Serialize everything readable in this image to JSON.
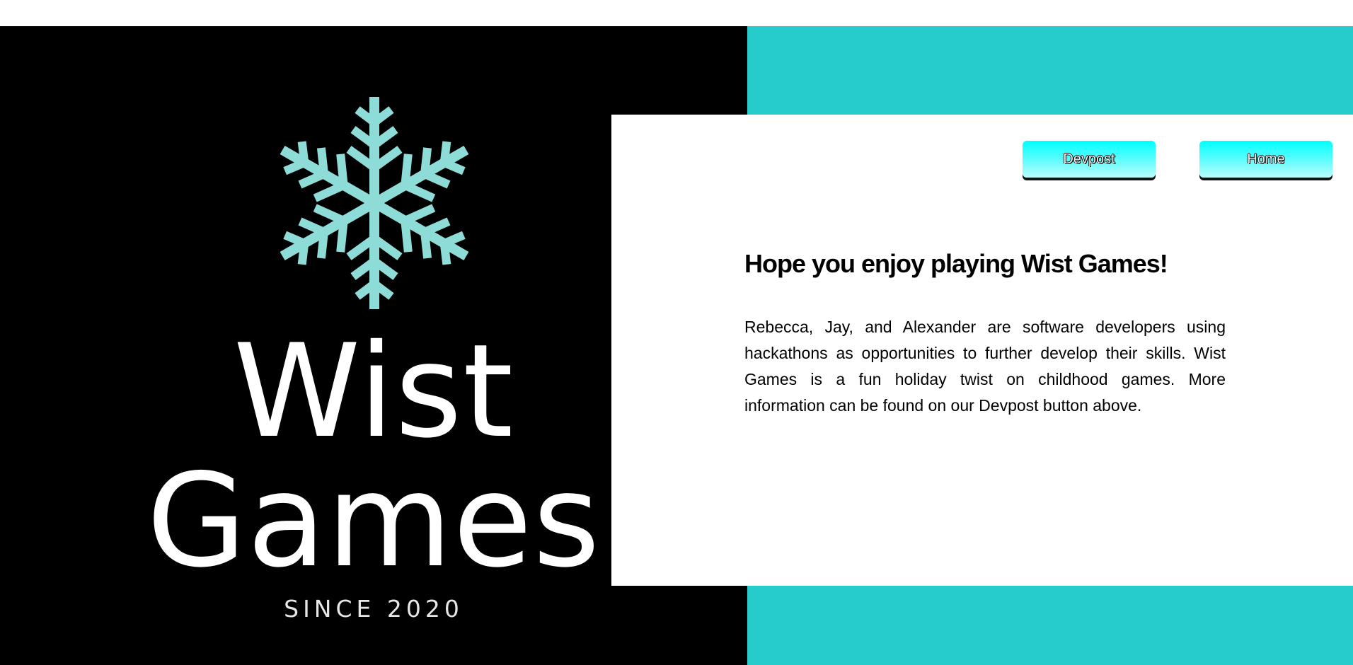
{
  "colors": {
    "logo_background": "#000000",
    "accent_teal": "#26cbcb",
    "snowflake": "#8edcd8",
    "button_gradient_top": "#00ffff",
    "card_background": "#ffffff"
  },
  "logo": {
    "icon": "snowflake-icon",
    "title_line_1": "Wist",
    "title_line_2": "Games",
    "tagline": "SINCE 2020"
  },
  "nav": {
    "devpost_label": "Devpost",
    "home_label": "Home"
  },
  "main": {
    "heading": "Hope you enjoy playing Wist Games!",
    "paragraph": "Rebecca, Jay, and Alexander are software developers using hackathons as opportunities to further develop their skills. Wist Games is a fun holiday twist on childhood games. More information can be found on our Devpost button above."
  }
}
